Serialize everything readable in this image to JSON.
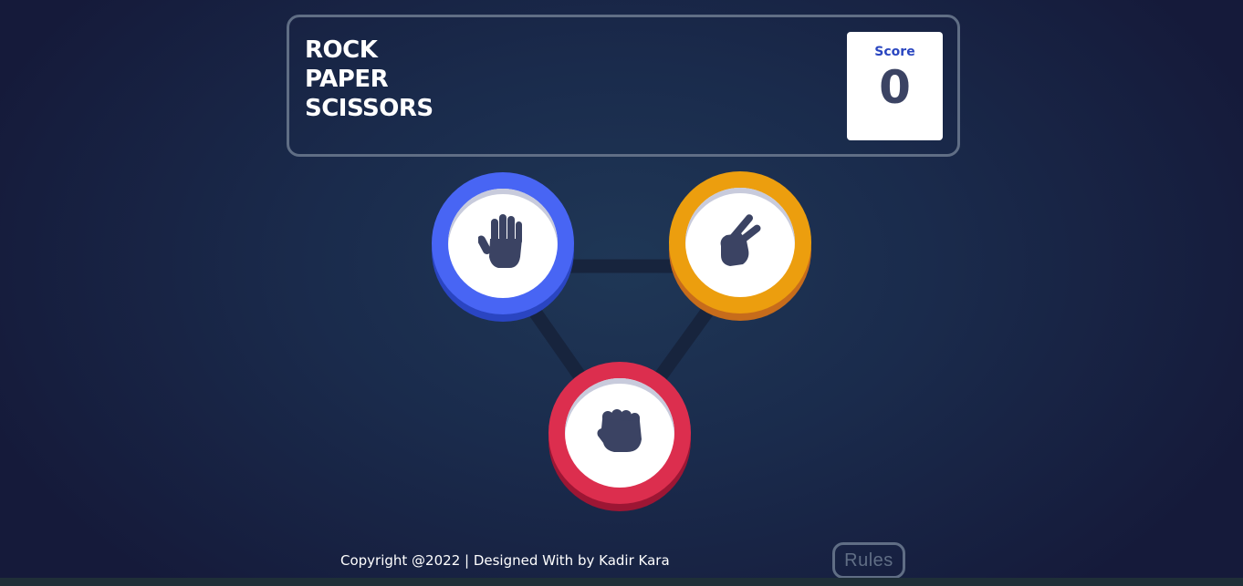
{
  "header": {
    "title_lines": [
      "ROCK",
      "PAPER",
      "SCISSORS"
    ],
    "score_label": "Score",
    "score_value": "0"
  },
  "choices": [
    {
      "id": "paper",
      "icon": "hand-paper-icon",
      "color": "#4865f4",
      "shadow": "#2a45c2"
    },
    {
      "id": "scissors",
      "icon": "hand-scissors-icon",
      "color": "#ec9e0e",
      "shadow": "#c76c1b"
    },
    {
      "id": "rock",
      "icon": "hand-rock-icon",
      "color": "#dc2e4e",
      "shadow": "#9d1634"
    }
  ],
  "footer": {
    "copyright": "Copyright @2022 | Designed With by Kadir Kara",
    "rules_label": "Rules"
  },
  "colors": {
    "background_center": "#1f3756",
    "background_edge": "#151a3a",
    "header_outline": "#606e85",
    "score_text": "#2a46c0",
    "dark_text": "#3b4363"
  }
}
